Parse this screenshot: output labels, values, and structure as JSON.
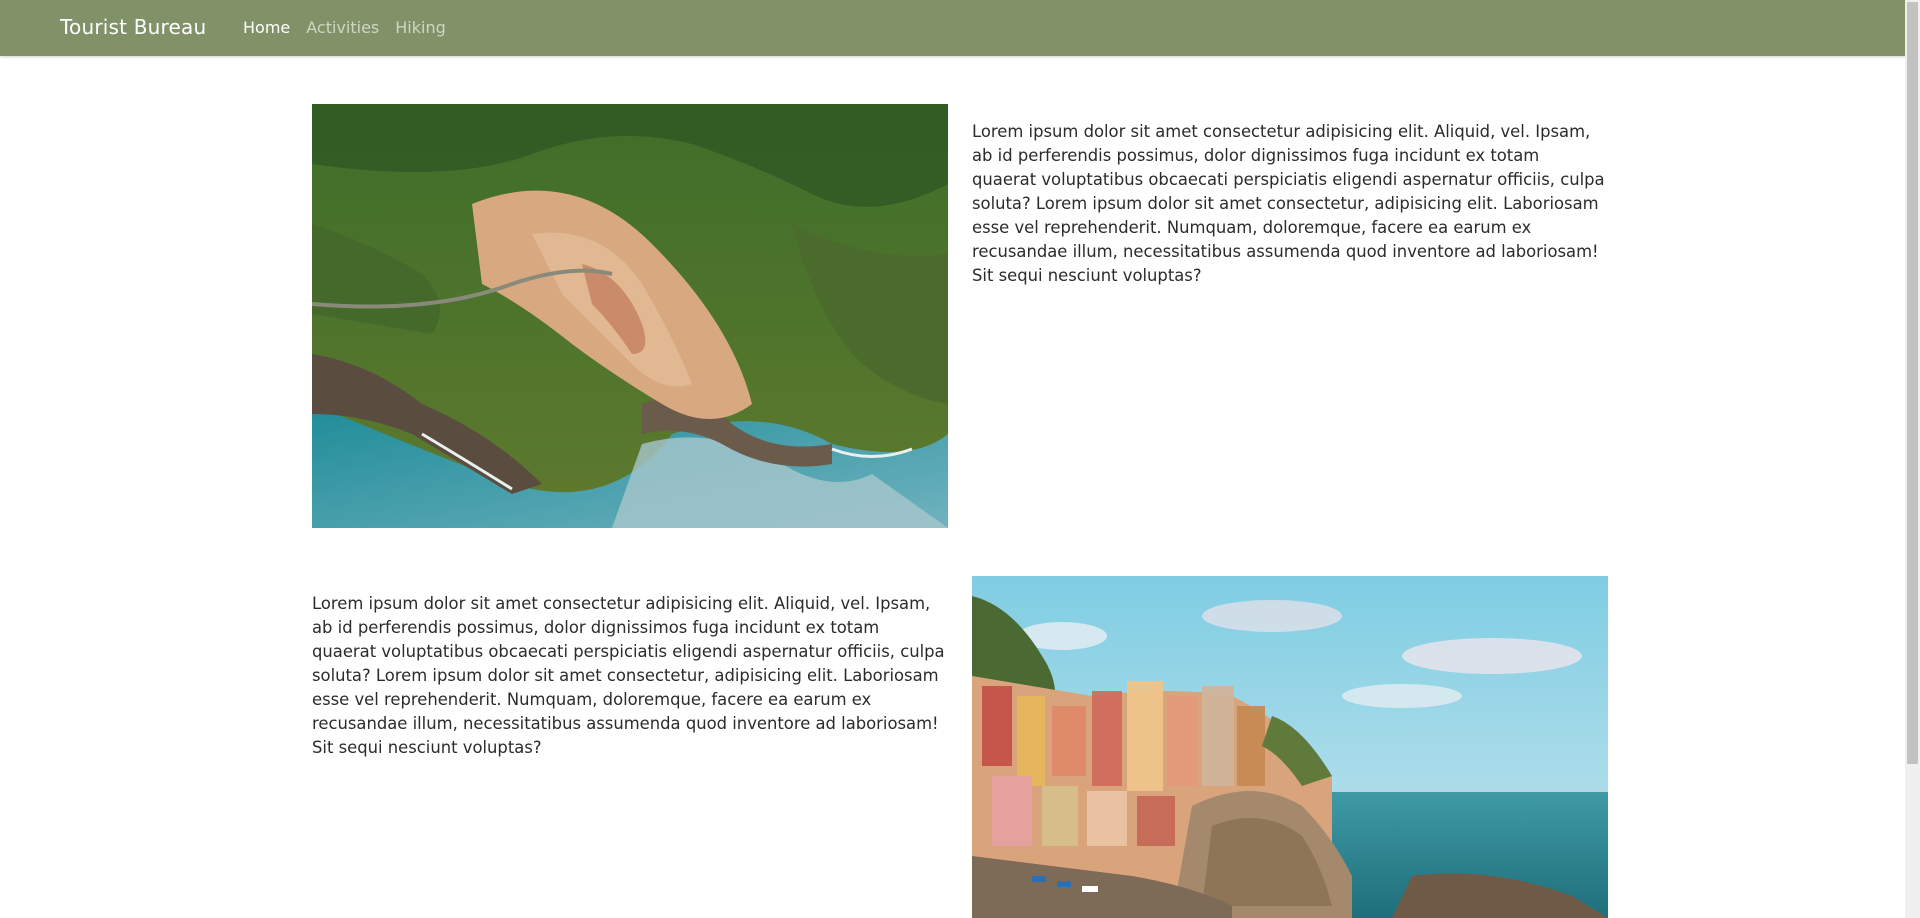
{
  "navbar": {
    "brand": "Tourist Bureau",
    "links": [
      {
        "label": "Home",
        "active": true
      },
      {
        "label": "Activities",
        "active": false
      },
      {
        "label": "Hiking",
        "active": false
      }
    ],
    "color": "#819268"
  },
  "sections": [
    {
      "image": "aerial-coastal-village-photo",
      "text": "Lorem ipsum dolor sit amet consectetur adipisicing elit. Aliquid, vel. Ipsam, ab id perferendis possimus, dolor dignissimos fuga incidunt ex totam quaerat voluptatibus obcaecati perspiciatis eligendi aspernatur officiis, culpa soluta? Lorem ipsum dolor sit amet consectetur, adipisicing elit. Laboriosam esse vel reprehenderit. Numquam, doloremque, facere ea earum ex recusandae illum, necessitatibus assumenda quod inventore ad laboriosam! Sit sequi nesciunt voluptas?"
    },
    {
      "image": "cliffside-colorful-village-photo",
      "text": "Lorem ipsum dolor sit amet consectetur adipisicing elit. Aliquid, vel. Ipsam, ab id perferendis possimus, dolor dignissimos fuga incidunt ex totam quaerat voluptatibus obcaecati perspiciatis eligendi aspernatur officiis, culpa soluta? Lorem ipsum dolor sit amet consectetur, adipisicing elit. Laboriosam esse vel reprehenderit. Numquam, doloremque, facere ea earum ex recusandae illum, necessitatibus assumenda quod inventore ad laboriosam! Sit sequi nesciunt voluptas?"
    }
  ]
}
